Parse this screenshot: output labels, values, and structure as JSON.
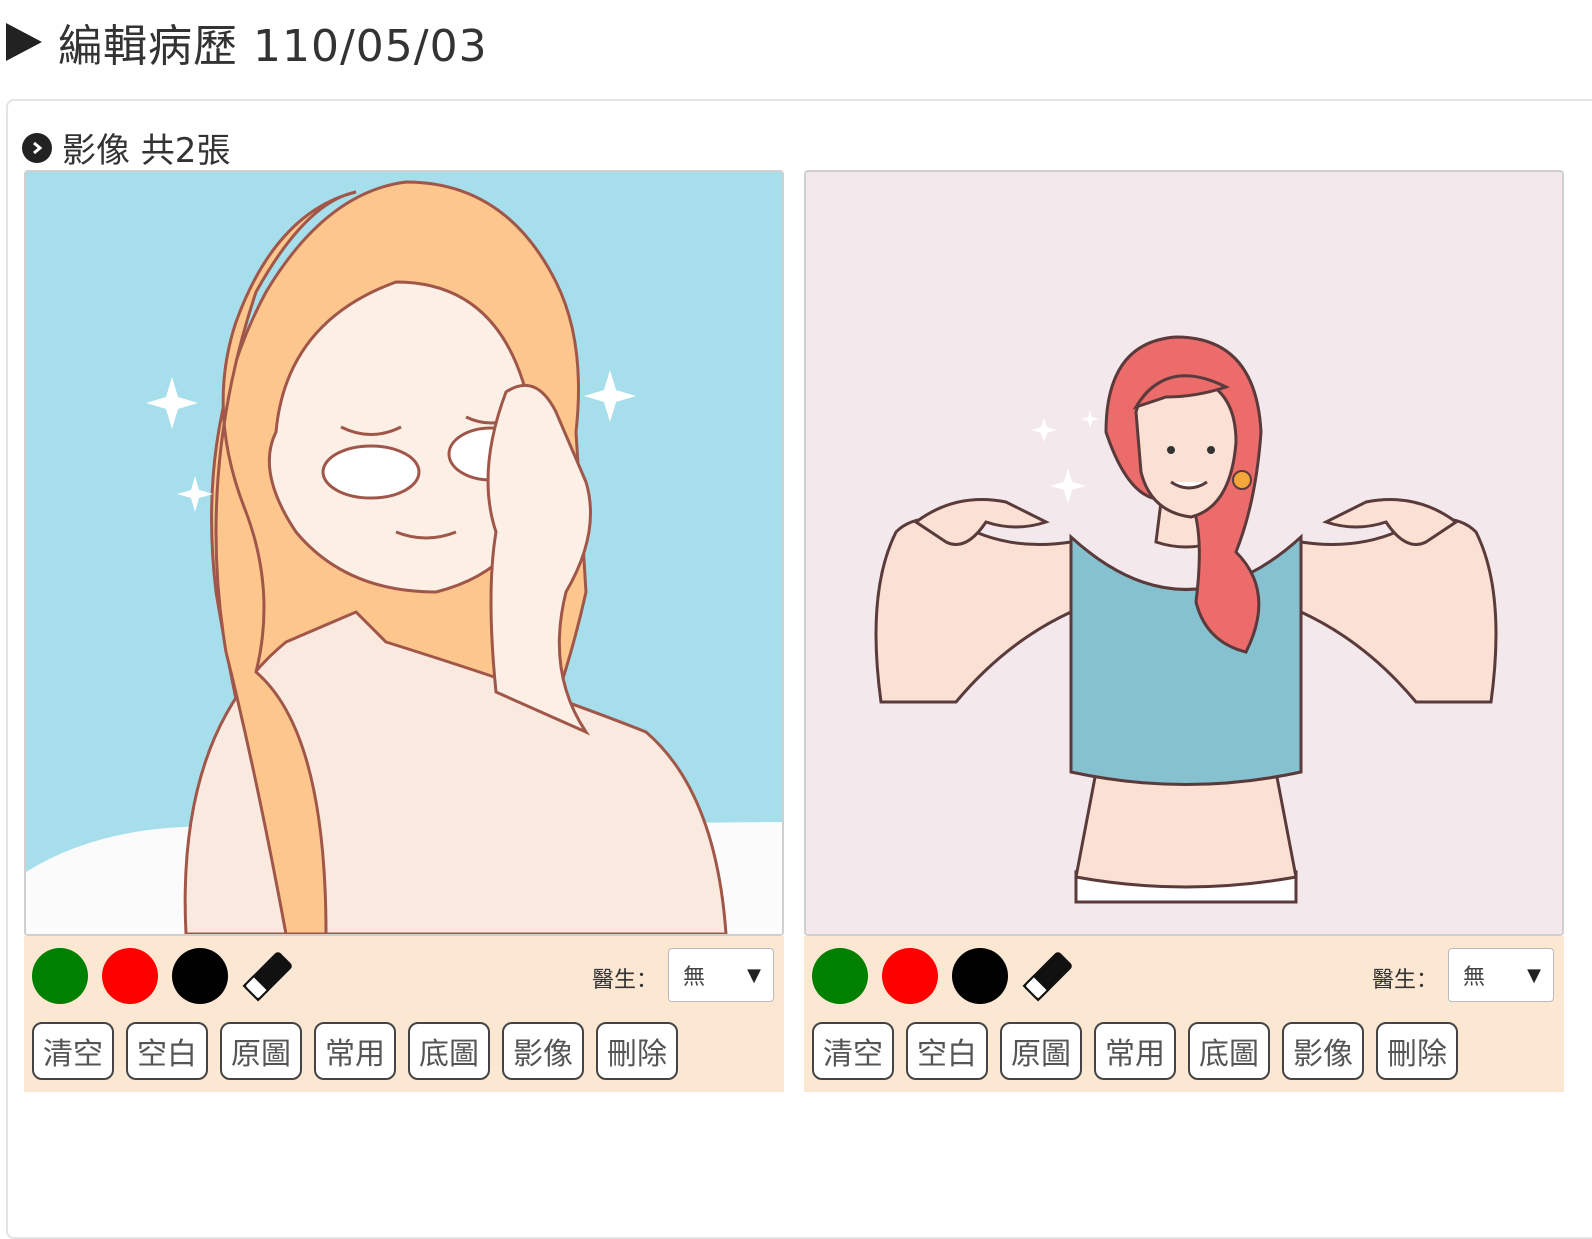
{
  "page": {
    "title": "編輯病歷 110/05/03"
  },
  "images_section": {
    "title": "影像 共2張"
  },
  "colors": {
    "green": "#008000",
    "red": "#ff0000",
    "black": "#000000",
    "tools_bg": "#fbe7d2"
  },
  "cards": [
    {
      "doctor_label": "醫生：",
      "doctor_value": "無",
      "buttons": [
        "清空",
        "空白",
        "原圖",
        "常用",
        "底圖",
        "影像",
        "刪除"
      ]
    },
    {
      "doctor_label": "醫生：",
      "doctor_value": "無",
      "buttons": [
        "清空",
        "空白",
        "原圖",
        "常用",
        "底圖",
        "影像",
        "刪除"
      ]
    }
  ]
}
